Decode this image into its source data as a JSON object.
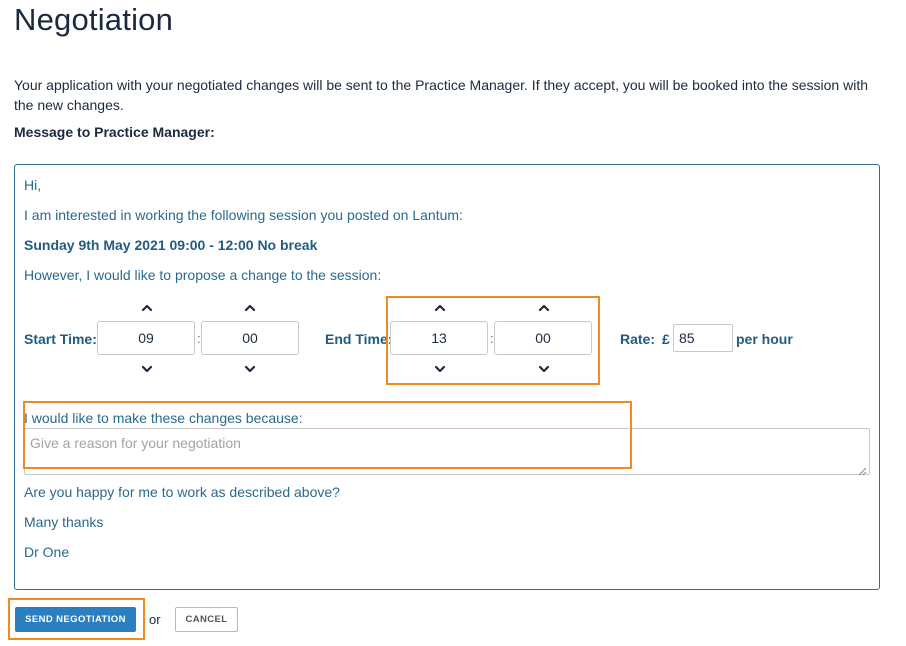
{
  "page": {
    "title": "Negotiation",
    "intro": "Your application with your negotiated changes will be sent to the Practice Manager. If they accept, you will be booked into the session with the new changes.",
    "message_label": "Message to Practice Manager:"
  },
  "message": {
    "greeting": "Hi,",
    "interest_line": "I am interested in working the following session you posted on Lantum:",
    "session": "Sunday 9th May 2021 09:00 - 12:00 No break",
    "propose_line": "However, I would like to propose a change to the session:",
    "start_label": "Start Time:",
    "start_hour": "09",
    "start_minute": "00",
    "end_label": "End Time:",
    "end_hour": "13",
    "end_minute": "00",
    "time_separator": ":",
    "rate_label": "Rate:",
    "currency": "£",
    "rate_value": "85",
    "rate_unit": "per hour",
    "reason_label": "I would like to make these changes because:",
    "reason_placeholder": "Give a reason for your negotiation",
    "question_line": "Are you happy for me to work as described above?",
    "thanks": "Many thanks",
    "signature": "Dr One"
  },
  "actions": {
    "send_label": "SEND NEGOTIATION",
    "or_text": "or",
    "cancel_label": "CANCEL"
  },
  "icons": {
    "up": "chevron-up-icon",
    "down": "chevron-down-icon",
    "resize": "resize-grip-icon"
  },
  "colors": {
    "heading": "#1b2a3f",
    "message_text": "#2a6a8c",
    "primary_button": "#2a7fc0",
    "highlight": "#f08a1f",
    "border": "#2f6b90"
  }
}
